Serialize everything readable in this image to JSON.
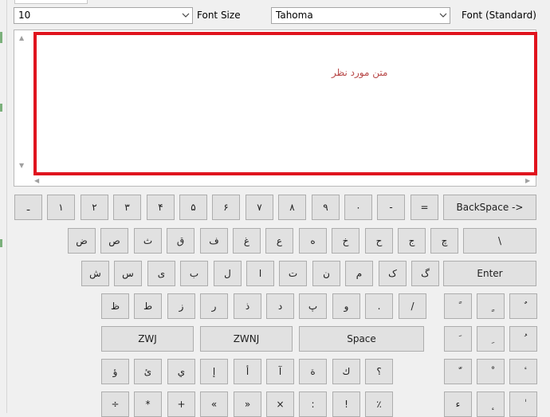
{
  "toolbar": {
    "font_size_value": "10",
    "font_size_label": "Font Size",
    "font_value": "Tahoma",
    "font_label": "Font (Standard)"
  },
  "text_area": {
    "sample_text": "متن مورد نظر"
  },
  "keyboard": {
    "row1": [
      "ـ",
      "١",
      "٢",
      "٣",
      "۴",
      "۵",
      "۶",
      "٧",
      "٨",
      "٩",
      "٠",
      "-",
      "=",
      "BackSpace ->"
    ],
    "row2": [
      "ض",
      "ص",
      "ث",
      "ق",
      "ف",
      "غ",
      "ع",
      "ه",
      "خ",
      "ح",
      "ج",
      "چ",
      "\\"
    ],
    "row3": [
      "ش",
      "س",
      "ی",
      "ب",
      "ل",
      "ا",
      "ت",
      "ن",
      "م",
      "ک",
      "گ",
      "Enter"
    ],
    "row4": [
      "ظ",
      "ط",
      "ز",
      "ر",
      "ذ",
      "د",
      "پ",
      "و",
      ".",
      "/",
      "ً",
      "ٍ",
      "ٌ"
    ],
    "row5": [
      "ZWJ",
      "ZWNJ",
      "Space",
      "َ",
      "ِ",
      "ُ"
    ],
    "row6": [
      "ؤ",
      "ئ",
      "ي",
      "إ",
      "أ",
      "آ",
      "ة",
      "ك",
      "؟",
      "ّ",
      "ْ",
      "ٔ"
    ],
    "row7": [
      "÷",
      "*",
      "+",
      "«",
      "»",
      "×",
      ":",
      "!",
      "٪",
      "ء",
      "ٕ",
      "ٰ"
    ]
  }
}
